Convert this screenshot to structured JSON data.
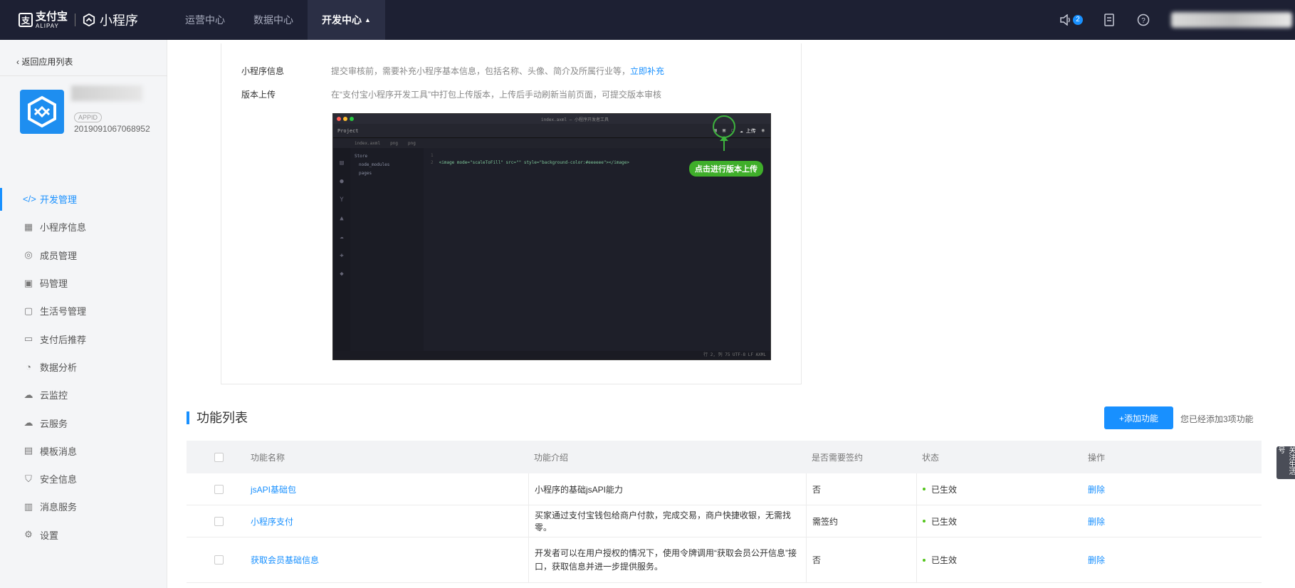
{
  "topbar": {
    "brand_alipay_cn": "支付宝",
    "brand_alipay_en": "ALIPAY",
    "brand_miniprogram": "小程序",
    "nav": [
      {
        "label": "运营中心"
      },
      {
        "label": "数据中心"
      },
      {
        "label": "开发中心"
      }
    ],
    "notice_count": "2"
  },
  "sidebar": {
    "back_label": "返回应用列表",
    "appid_badge": "APPID",
    "appid": "2019091067068952",
    "menu": [
      {
        "label": "开发管理",
        "icon": "code-icon"
      },
      {
        "label": "小程序信息",
        "icon": "grid-icon"
      },
      {
        "label": "成员管理",
        "icon": "user-icon"
      },
      {
        "label": "码管理",
        "icon": "qrcode-icon"
      },
      {
        "label": "生活号管理",
        "icon": "profile-icon"
      },
      {
        "label": "支付后推荐",
        "icon": "laptop-icon"
      },
      {
        "label": "数据分析",
        "icon": "pie-chart-icon"
      },
      {
        "label": "云监控",
        "icon": "cloud-icon"
      },
      {
        "label": "云服务",
        "icon": "cloud-icon"
      },
      {
        "label": "模板消息",
        "icon": "message-icon"
      },
      {
        "label": "安全信息",
        "icon": "shield-icon"
      },
      {
        "label": "消息服务",
        "icon": "monitor-icon"
      },
      {
        "label": "设置",
        "icon": "gear-icon"
      }
    ]
  },
  "info": {
    "row1_label": "小程序信息",
    "row1_desc": "提交审核前，需要补充小程序基本信息，包括名称、头像、简介及所属行业等，",
    "row1_link": "立即补充",
    "row2_label": "版本上传",
    "row2_desc": "在“支付宝小程序开发工具”中打包上传版本，上传后手动刷新当前页面，可提交版本审核"
  },
  "ide_shot": {
    "title": "index.axml — 小程序开发者工具",
    "upload_tip": "点击进行版本上传",
    "upload_label": "上传",
    "project_label": "Project",
    "tree": [
      "Store",
      "node_modules",
      "pages"
    ],
    "code_line": "<image mode=\"scaleToFill\" src=\"\" style=\"background-color:#eeeeee\"></image>",
    "status": "行 2, 列 75    UTF-8    LF    AXML"
  },
  "functions": {
    "title": "功能列表",
    "add_button": "+添加功能",
    "added_count": "您已经添加3项功能",
    "columns": [
      "功能名称",
      "功能介绍",
      "是否需要签约",
      "状态",
      "操作"
    ],
    "rows": [
      {
        "name": "jsAPI基础包",
        "desc": "小程序的基础jsAPI能力",
        "sign": "否",
        "status": "已生效",
        "op": "删除"
      },
      {
        "name": "小程序支付",
        "desc": "买家通过支付宝钱包给商户付款，完成交易，商户快捷收银，无需找零。",
        "sign": "需签约",
        "status": "已生效",
        "op": "删除"
      },
      {
        "name": "获取会员基础信息",
        "desc": "开发者可以在用户授权的情况下，使用令牌调用“获取会员公开信息”接口，获取信息并进一步提供服务。",
        "sign": "否",
        "status": "已生效",
        "op": "删除"
      }
    ]
  },
  "float_tab": "关注生活号"
}
